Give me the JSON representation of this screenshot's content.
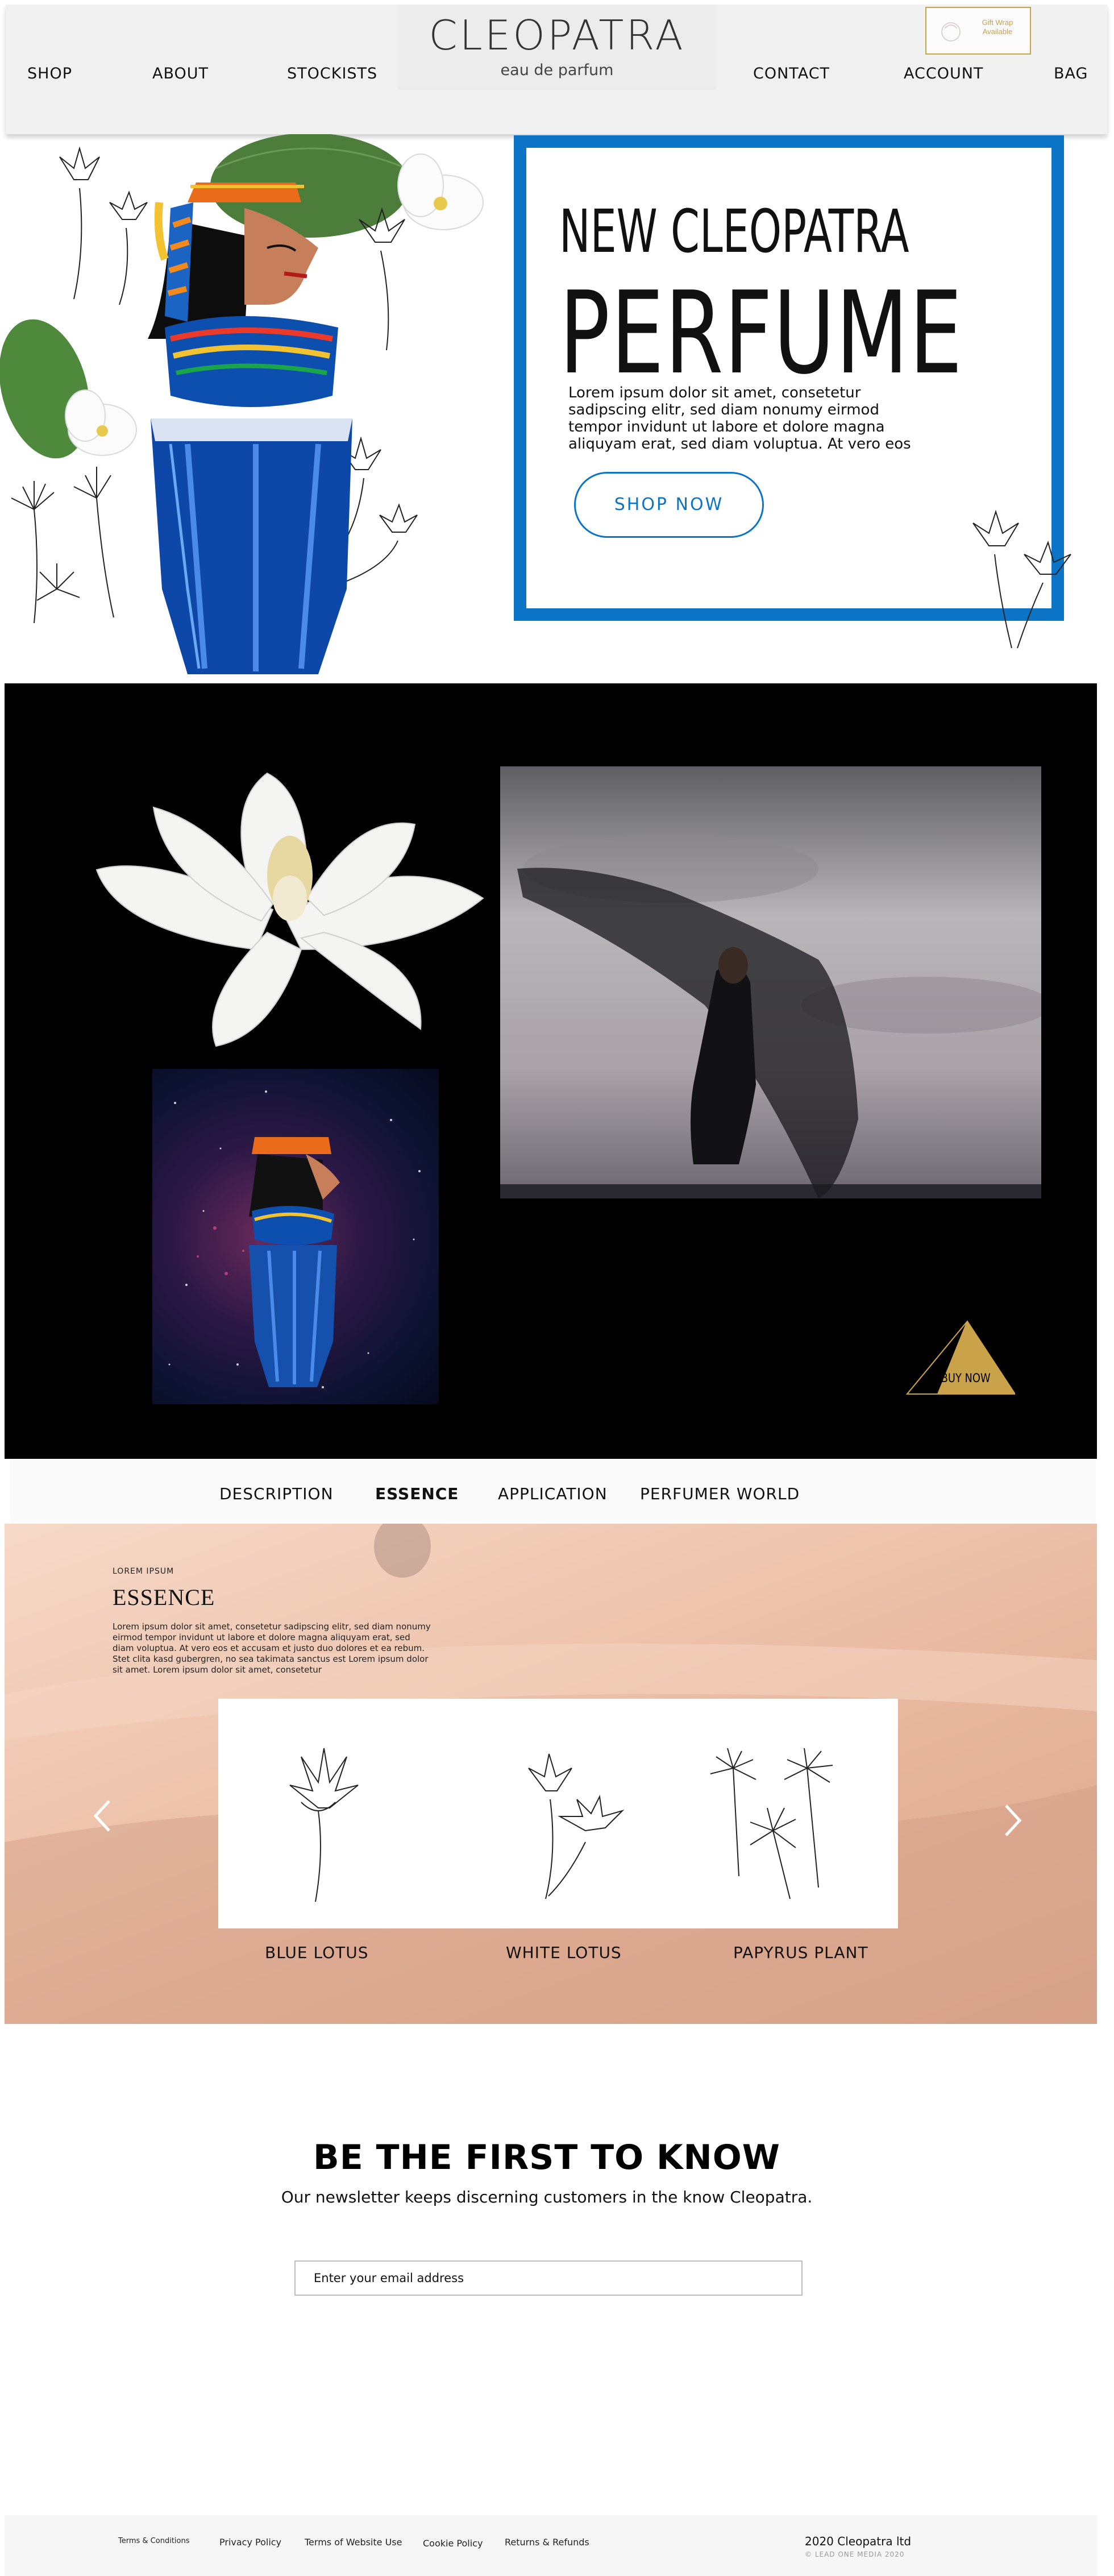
{
  "header": {
    "nav_left": [
      "SHOP",
      "ABOUT",
      "STOCKISTS"
    ],
    "nav_right": [
      "CONTACT",
      "ACCOUNT",
      "BAG"
    ],
    "brand": "CLEOPATRA",
    "brand_sub": "eau de parfum",
    "gift_badge": "Gift Wrap Available"
  },
  "hero": {
    "line1": "NEW CLEOPATRA",
    "line2": "PERFUME",
    "body": "Lorem ipsum dolor sit amet, consetetur sadipscing elitr, sed diam nonumy eirmod tempor invidunt ut labore et dolore magna aliquyam erat, sed diam voluptua. At vero eos",
    "button": "SHOP NOW"
  },
  "gallery": {
    "buy_now": "BUY NOW"
  },
  "tabs": {
    "items": [
      "DESCRIPTION",
      "ESSENCE",
      "APPLICATION",
      "PERFUMER WORLD"
    ],
    "active": "ESSENCE"
  },
  "essence": {
    "eyebrow": "LOREM IPSUM",
    "title": "ESSENCE",
    "body": "Lorem ipsum dolor sit amet, consetetur sadipscing elitr, sed diam nonumy eirmod tempor invidunt ut labore et dolore magna aliquyam erat, sed diam voluptua. At vero eos et accusam et justo duo dolores et ea rebum. Stet clita kasd gubergren, no sea takimata sanctus est Lorem ipsum dolor sit amet. Lorem ipsum dolor sit amet, consetetur",
    "plants": [
      "BLUE LOTUS",
      "WHITE LOTUS",
      "PAPYRUS PLANT"
    ],
    "prev_icon": "chevron-left-icon",
    "next_icon": "chevron-right-icon"
  },
  "newsletter": {
    "title": "BE THE FIRST TO KNOW",
    "subtitle": "Our newsletter keeps discerning customers in the know Cleopatra.",
    "placeholder": "Enter your email address"
  },
  "footer": {
    "links": [
      "Terms & Conditions",
      "Privacy Policy",
      "Terms of Website Use",
      "Cookie Policy",
      "Returns & Refunds"
    ],
    "copyright": "2020 Cleopatra ltd",
    "credit": "© LEAD ONE MEDIA 2020"
  },
  "colors": {
    "accent_blue": "#0b74c7",
    "gold": "#c9a24a",
    "gallery_bg": "#000000"
  }
}
